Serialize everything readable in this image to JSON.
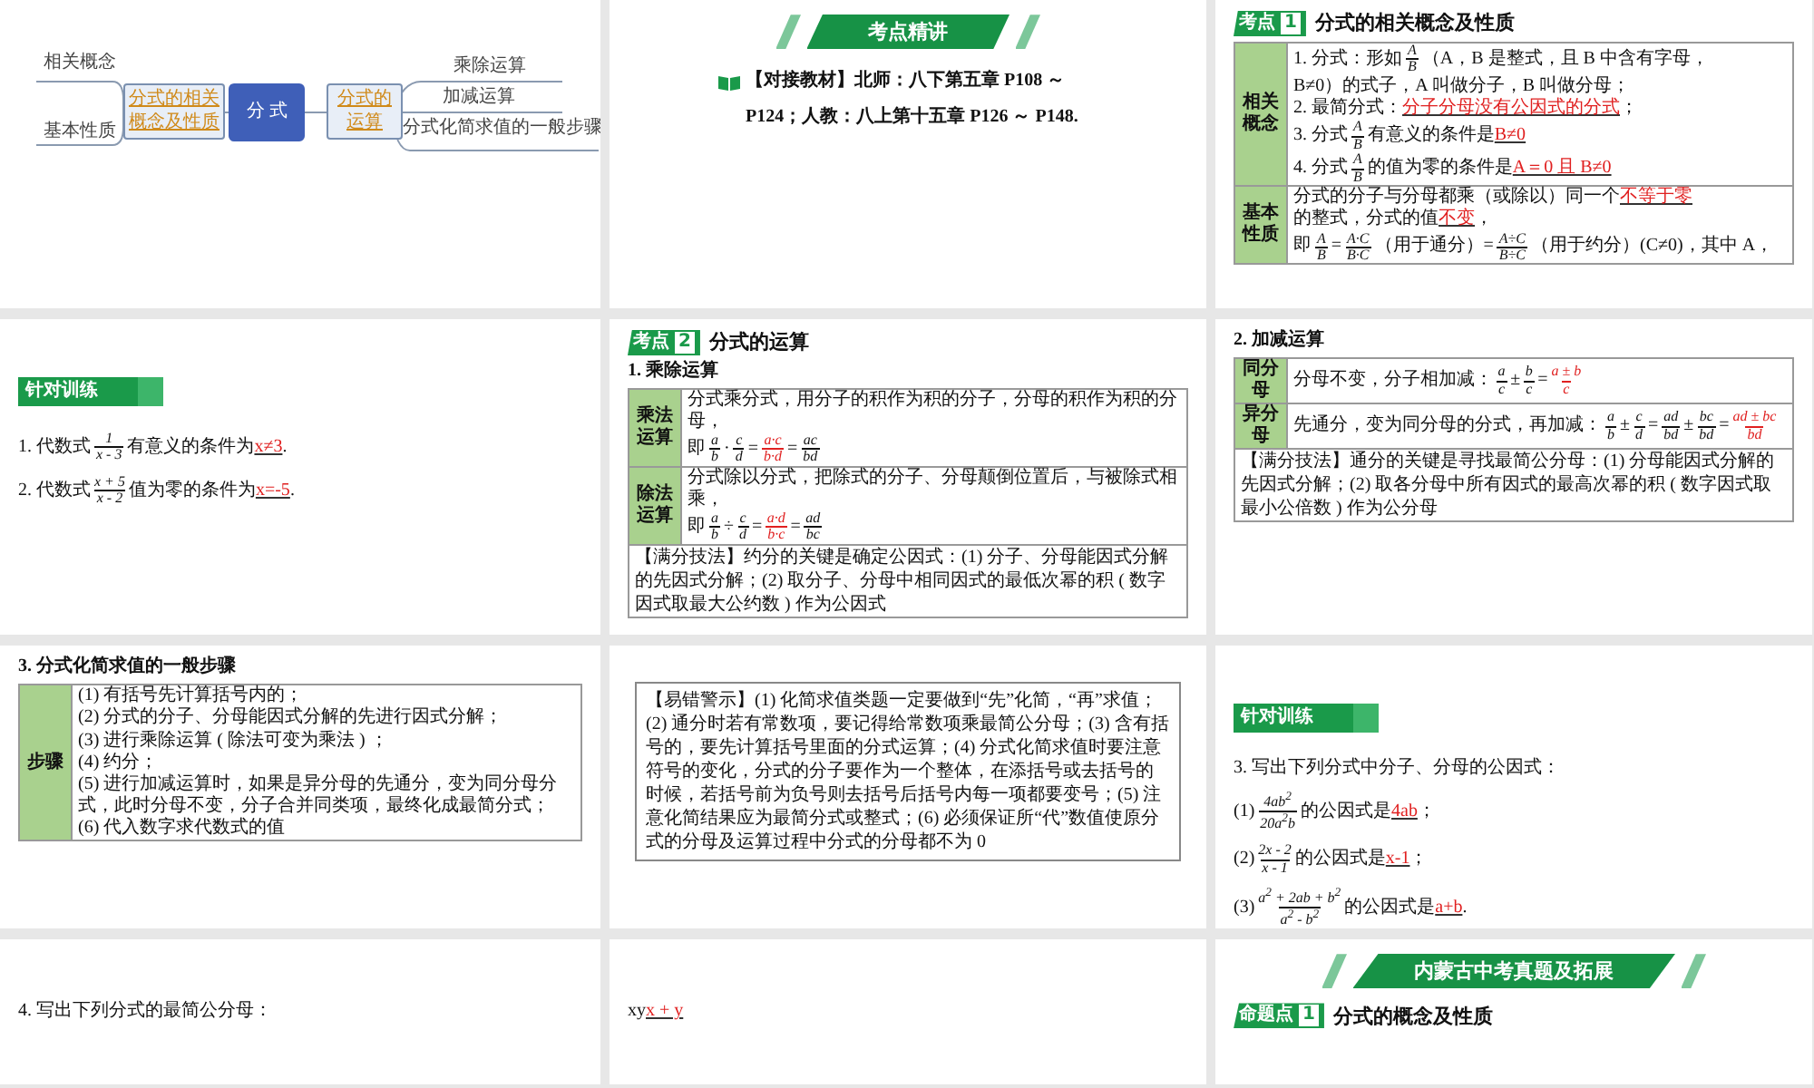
{
  "slides": [
    {
      "kind": "mindmap",
      "center": "分 式",
      "left": {
        "label": "分式的相关概念及性质",
        "leaves": [
          "相关概念",
          "基本性质"
        ]
      },
      "right": {
        "label": "分式的运算",
        "leaves": [
          "乘除运算",
          "加减运算",
          "分式化简求值的一般步骤"
        ]
      }
    },
    {
      "kind": "content",
      "banner": "考点精讲",
      "blocks": [
        {
          "kind": "reference",
          "text": "【对接教材】北师：八下第五章 P108 ～ P124；人教：八上第十五章 P126 ～ P148."
        }
      ]
    },
    {
      "kind": "content",
      "heading": {
        "tag": "考点",
        "num": "1",
        "title": "分式的相关概念及性质"
      },
      "blocks": [
        {
          "kind": "table",
          "rows": [
            {
              "head": "相关概念",
              "lines": [
                [
                  {
                    "kind": "text",
                    "text": "1. 分式：形如"
                  },
                  {
                    "kind": "frac",
                    "frac": [
                      "A",
                      "B"
                    ]
                  },
                  {
                    "kind": "text",
                    "text": "（A，B 是整式，且 B 中含有字母，"
                  },
                  {
                    "kind": "text",
                    "text": "B≠0）的式子，A 叫做分子，B 叫做分母；"
                  }
                ],
                [
                  {
                    "kind": "text",
                    "text": "2. 最简分式："
                  },
                  {
                    "kind": "answer",
                    "text": "分子分母没有公因式的分式"
                  },
                  {
                    "kind": "text",
                    "text": "；"
                  }
                ],
                [
                  {
                    "kind": "text",
                    "text": "3. 分式"
                  },
                  {
                    "kind": "frac",
                    "frac": [
                      "A",
                      "B"
                    ]
                  },
                  {
                    "kind": "text",
                    "text": "有意义的条件是"
                  },
                  {
                    "kind": "answer",
                    "text": "B≠0"
                  }
                ],
                [
                  {
                    "kind": "text",
                    "text": "4. 分式"
                  },
                  {
                    "kind": "frac",
                    "frac": [
                      "A",
                      "B"
                    ]
                  },
                  {
                    "kind": "text",
                    "text": "的值为零的条件是"
                  },
                  {
                    "kind": "answer",
                    "text": "A＝0 且 B≠0"
                  }
                ]
              ]
            },
            {
              "head": "基本性质",
              "lines": [
                [
                  {
                    "kind": "text",
                    "text": "分式的分子与分母都乘（或除以）"
                  },
                  {
                    "kind": "text",
                    "text": "同一个"
                  },
                  {
                    "kind": "answer",
                    "text": "不等于零"
                  },
                  {
                    "kind": "text",
                    "text": "的整式，分式的值"
                  },
                  {
                    "kind": "answer",
                    "text": "不变"
                  },
                  {
                    "kind": "text",
                    "text": "，"
                  }
                ],
                [
                  {
                    "kind": "text",
                    "text": "即"
                  },
                  {
                    "kind": "frac",
                    "frac": [
                      "A",
                      "B"
                    ]
                  },
                  {
                    "kind": "text",
                    "text": "="
                  },
                  {
                    "kind": "frac",
                    "frac": [
                      "A·C",
                      "B·C"
                    ]
                  },
                  {
                    "kind": "text",
                    "text": "（用于通分）="
                  },
                  {
                    "kind": "frac",
                    "frac": [
                      "A÷C",
                      "B÷C"
                    ]
                  },
                  {
                    "kind": "text",
                    "text": "（用于约分）"
                  },
                  {
                    "kind": "text",
                    "text": "(C≠0)，其中 A，"
                  }
                ]
              ]
            }
          ]
        }
      ]
    },
    {
      "kind": "content",
      "practice_tag": "针对训练",
      "blocks": [
        {
          "kind": "lines",
          "lines": [
            [
              {
                "kind": "text",
                "text": "1. 代数式"
              },
              {
                "kind": "frac",
                "frac": [
                  "1",
                  "x - 3"
                ]
              },
              {
                "kind": "text",
                "text": "有意义的条件为"
              },
              {
                "kind": "answer",
                "text": "x≠3"
              },
              {
                "kind": "text",
                "text": "."
              }
            ],
            [
              {
                "kind": "text",
                "text": "2. 代数式"
              },
              {
                "kind": "frac",
                "frac": [
                  "x + 5",
                  "x - 2"
                ]
              },
              {
                "kind": "text",
                "text": "值为零的条件为"
              },
              {
                "kind": "answer",
                "text": "x=-5"
              },
              {
                "kind": "text",
                "text": "."
              }
            ]
          ]
        }
      ]
    },
    {
      "kind": "content",
      "heading": {
        "tag": "考点",
        "num": "2",
        "title": "分式的运算"
      },
      "subtitle": "1. 乘除运算",
      "blocks": [
        {
          "kind": "table",
          "rows": [
            {
              "head": "乘法运算",
              "lines": [
                [
                  {
                    "kind": "text",
                    "text": "分式乘分式，用分子的积作为积的分子，分母的积作为积的分母，"
                  },
                  {
                    "kind": "text",
                    "text": "即"
                  },
                  {
                    "kind": "frac",
                    "frac": [
                      "a",
                      "b"
                    ]
                  },
                  {
                    "kind": "text",
                    "text": "·"
                  },
                  {
                    "kind": "frac",
                    "frac": [
                      "c",
                      "d"
                    ]
                  },
                  {
                    "kind": "text",
                    "text": "="
                  },
                  {
                    "kind": "answer-frac",
                    "frac": [
                      "a·c",
                      "b·d"
                    ]
                  },
                  {
                    "kind": "text",
                    "text": "="
                  },
                  {
                    "kind": "frac",
                    "frac": [
                      "ac",
                      "bd"
                    ]
                  }
                ]
              ]
            },
            {
              "head": "除法运算",
              "lines": [
                [
                  {
                    "kind": "text",
                    "text": "分式除以分式，把除式的分子、分母颠倒位置后，与被除式相乘，"
                  },
                  {
                    "kind": "text",
                    "text": "即"
                  },
                  {
                    "kind": "frac",
                    "frac": [
                      "a",
                      "b"
                    ]
                  },
                  {
                    "kind": "text",
                    "text": "÷"
                  },
                  {
                    "kind": "frac",
                    "frac": [
                      "c",
                      "d"
                    ]
                  },
                  {
                    "kind": "text",
                    "text": "="
                  },
                  {
                    "kind": "answer-frac",
                    "frac": [
                      "a·d",
                      "b·c"
                    ]
                  },
                  {
                    "kind": "text",
                    "text": "="
                  },
                  {
                    "kind": "frac",
                    "frac": [
                      "ad",
                      "bc"
                    ]
                  }
                ]
              ]
            }
          ],
          "note": "【满分技法】约分的关键是确定公因式：(1) 分子、分母能因式分解的先因式分解；(2) 取分子、分母中相同因式的最低次幂的积 ( 数字因式取最大公约数 ) 作为公因式"
        }
      ]
    },
    {
      "kind": "content",
      "subtitle": "2. 加减运算",
      "blocks": [
        {
          "kind": "table",
          "rows": [
            {
              "head": "同分母",
              "lines": [
                [
                  {
                    "kind": "text",
                    "text": "分母不变，分子相加减："
                  },
                  {
                    "kind": "frac",
                    "frac": [
                      "a",
                      "c"
                    ]
                  },
                  {
                    "kind": "text",
                    "text": "±"
                  },
                  {
                    "kind": "frac",
                    "frac": [
                      "b",
                      "c"
                    ]
                  },
                  {
                    "kind": "text",
                    "text": "="
                  },
                  {
                    "kind": "answer-frac",
                    "frac": [
                      "a ± b",
                      "c"
                    ]
                  }
                ]
              ]
            },
            {
              "head": "异分母",
              "lines": [
                [
                  {
                    "kind": "text",
                    "text": "先通分，变为同分母的分式，再加减："
                  },
                  {
                    "kind": "frac",
                    "frac": [
                      "a",
                      "b"
                    ]
                  },
                  {
                    "kind": "text",
                    "text": "±"
                  },
                  {
                    "kind": "frac",
                    "frac": [
                      "c",
                      "d"
                    ]
                  },
                  {
                    "kind": "text",
                    "text": "="
                  },
                  {
                    "kind": "frac",
                    "frac": [
                      "ad",
                      "bd"
                    ]
                  },
                  {
                    "kind": "text",
                    "text": "±"
                  },
                  {
                    "kind": "frac",
                    "frac": [
                      "bc",
                      "bd"
                    ]
                  },
                  {
                    "kind": "text",
                    "text": "="
                  },
                  {
                    "kind": "answer-frac",
                    "frac": [
                      "ad ± bc",
                      "bd"
                    ]
                  }
                ]
              ]
            }
          ],
          "note": "【满分技法】通分的关键是寻找最简公分母：(1) 分母能因式分解的先因式分解；(2) 取各分母中所有因式的最高次幂的积 ( 数字因式取最小公倍数 ) 作为公分母"
        }
      ]
    },
    {
      "kind": "content",
      "subtitle": "3. 分式化简求值的一般步骤",
      "blocks": [
        {
          "kind": "table",
          "rows": [
            {
              "head": "步骤",
              "lines": [
                [
                  {
                    "kind": "text",
                    "text": "(1) 有括号先计算括号内的；"
                  }
                ],
                [
                  {
                    "kind": "text",
                    "text": "(2) 分式的分子、分母能因式分解的先进行因式分解；"
                  }
                ],
                [
                  {
                    "kind": "text",
                    "text": "(3) 进行乘除运算 ( 除法可变为乘法 ) ；"
                  }
                ],
                [
                  {
                    "kind": "text",
                    "text": "(4) 约分；"
                  }
                ],
                [
                  {
                    "kind": "text",
                    "text": "(5) 进行加减运算时，如果是异分母的先通分，变为同分母分式，此时分母不变，分子合并同类项，最终化成最简分式；"
                  }
                ],
                [
                  {
                    "kind": "text",
                    "text": "(6) 代入数字求代数式的值"
                  }
                ]
              ]
            }
          ]
        }
      ]
    },
    {
      "kind": "content",
      "blocks": [
        {
          "kind": "note",
          "text": "【易错警示】(1) 化简求值类题一定要做到“先”化简，“再”求值；(2) 通分时若有常数项，要记得给常数项乘最简公分母；(3) 含有括号的，要先计算括号里面的分式运算；(4) 分式化简求值时要注意符号的变化，分式的分子要作为一个整体，在添括号或去括号的时候，若括号前为负号则去括号后括号内每一项都要变号；(5) 注意化简结果应为最简分式或整式；(6) 必须保证所“代”数值使原分式的分母及运算过程中分式的分母都不为 0"
        }
      ]
    },
    {
      "kind": "content",
      "practice_tag": "针对训练",
      "blocks": [
        {
          "kind": "lines",
          "lines": [
            [
              {
                "kind": "text",
                "text": "3. 写出下列分式中分子、分母的公因式："
              }
            ],
            [
              {
                "kind": "text",
                "text": "(1)"
              },
              {
                "kind": "frac",
                "frac": [
                  "4ab$^{2}$",
                  "20a$^{2}$b"
                ]
              },
              {
                "kind": "text",
                "text": "的公因式是"
              },
              {
                "kind": "answer",
                "text": "4ab"
              },
              {
                "kind": "text",
                "text": "；"
              }
            ],
            [
              {
                "kind": "text",
                "text": "(2)"
              },
              {
                "kind": "frac",
                "frac": [
                  "2x - 2",
                  "x - 1"
                ]
              },
              {
                "kind": "text",
                "text": "的公因式是"
              },
              {
                "kind": "answer",
                "text": "x-1"
              },
              {
                "kind": "text",
                "text": "；"
              }
            ],
            [
              {
                "kind": "text",
                "text": "(3)"
              },
              {
                "kind": "frac",
                "frac": [
                  "a$^{2}$ + 2ab + b$^{2}$",
                  "a$^{2}$ - b$^{2}$"
                ]
              },
              {
                "kind": "text",
                "text": "的公因式是"
              },
              {
                "kind": "answer",
                "text": "a+b"
              },
              {
                "kind": "text",
                "text": "."
              }
            ]
          ]
        }
      ]
    },
    {
      "kind": "content",
      "blocks": [
        {
          "kind": "lines",
          "lines": [
            [
              {
                "kind": "text",
                "text": "4. 写出下列分式的最简公分母："
              }
            ]
          ]
        }
      ]
    },
    {
      "kind": "content",
      "blocks": [
        {
          "kind": "lines",
          "lines": [
            [
              {
                "kind": "text",
                "text": "x"
              },
              {
                "kind": "text",
                "text": "y"
              },
              {
                "kind": "answer",
                "text": "x + y"
              }
            ]
          ]
        }
      ]
    },
    {
      "kind": "content",
      "banner": "内蒙古中考真题及拓展",
      "heading": {
        "tag": "命题点",
        "num": "1",
        "title": "分式的概念及性质"
      }
    }
  ]
}
